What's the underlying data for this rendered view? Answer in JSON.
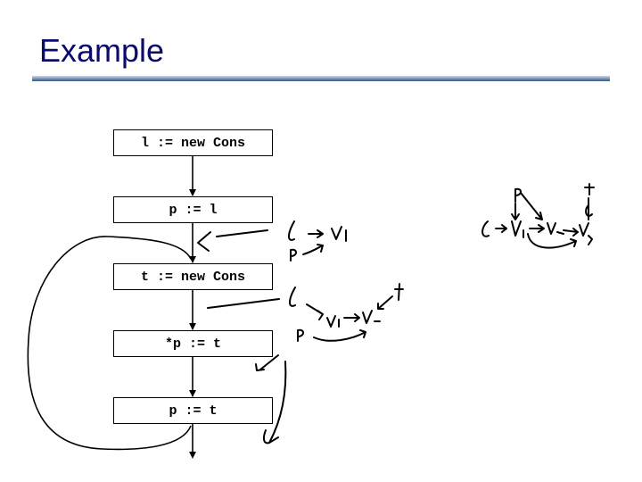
{
  "slide": {
    "title": "Example"
  },
  "flowchart": {
    "nodes": [
      {
        "id": "n1",
        "label": "l := new Cons"
      },
      {
        "id": "n2",
        "label": "p := l"
      },
      {
        "id": "n3",
        "label": "t := new Cons"
      },
      {
        "id": "n4",
        "label": "*p := t"
      },
      {
        "id": "n5",
        "label": "p := t"
      }
    ],
    "edges": [
      {
        "from": "n1",
        "to": "n2"
      },
      {
        "from": "n2",
        "to": "n3"
      },
      {
        "from": "n3",
        "to": "n4"
      },
      {
        "from": "n4",
        "to": "n5"
      },
      {
        "from": "n5",
        "to": "exit"
      },
      {
        "from": "n5",
        "to": "n3",
        "type": "loop-back"
      }
    ]
  },
  "annotations": {
    "after_p_assign": {
      "vars": [
        "l",
        "p"
      ],
      "nodes": [
        "v1"
      ],
      "points_to": [
        [
          "l",
          "v1"
        ],
        [
          "p",
          "v1"
        ]
      ]
    },
    "after_store": {
      "vars": [
        "l",
        "p",
        "t"
      ],
      "nodes": [
        "v1",
        "v2"
      ],
      "points_to": [
        [
          "l",
          "v1"
        ],
        [
          "v1",
          "v2"
        ],
        [
          "t",
          "v2"
        ],
        [
          "p",
          "v2"
        ]
      ]
    },
    "final_graph": {
      "vars": [
        "l",
        "p",
        "t"
      ],
      "nodes": [
        "v1",
        "v2",
        "v3"
      ],
      "points_to": [
        [
          "l",
          "v1"
        ],
        [
          "p",
          "v1"
        ],
        [
          "p",
          "v2"
        ],
        [
          "v1",
          "v2"
        ],
        [
          "v2",
          "v3"
        ],
        [
          "v1",
          "v3"
        ],
        [
          "t",
          "v3"
        ]
      ]
    }
  }
}
